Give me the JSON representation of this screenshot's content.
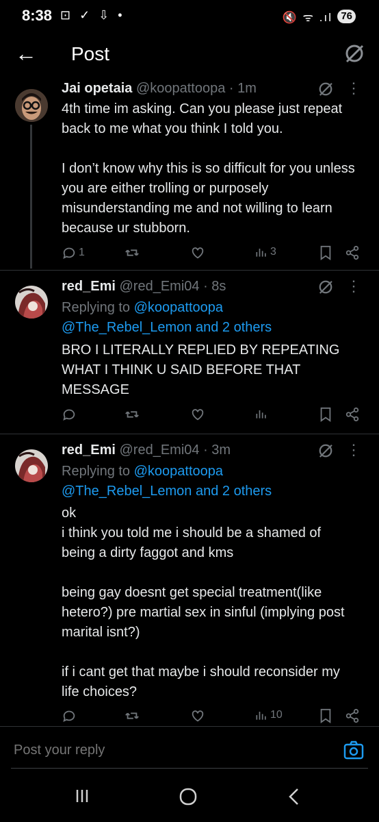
{
  "status": {
    "time": "8:38",
    "left_icons": "⊡ ✓ ⇩ •",
    "right_icons": "🔇 ᯤ .ıl",
    "battery": "76"
  },
  "header": {
    "title": "Post"
  },
  "posts": [
    {
      "name": "Jai opetaia",
      "handle": "@koopattoopa · 1m",
      "text": "4th time im asking. Can you please just repeat back to me what you think I told you.\n\nI don’t know why this is so difficult for you unless you are either trolling or purposely misunderstanding me and not willing to learn because ur stubborn.",
      "replies": "1",
      "views": "3"
    },
    {
      "name": "red_Emi",
      "handle": "@red_Emi04 · 8s",
      "replying_prefix": "Replying to ",
      "replying_to": "@koopattoopa",
      "replying_others": "@The_Rebel_Lemon and 2 others",
      "text": "BRO I LITERALLY REPLIED BY REPEATING WHAT I THINK U SAID BEFORE THAT MESSAGE",
      "views": ""
    },
    {
      "name": "red_Emi",
      "handle": "@red_Emi04 · 3m",
      "replying_prefix": "Replying to ",
      "replying_to": "@koopattoopa",
      "replying_others": "@The_Rebel_Lemon and 2 others",
      "text": "ok\ni think you told me i should be a shamed of being a dirty faggot and kms\n\nbeing gay doesnt get special treatment(like hetero?) pre martial sex in sinful (implying post marital isnt?)\n\nif i cant get that maybe i should reconsider my life choices?",
      "views": "10"
    }
  ],
  "reply_bar": {
    "placeholder": "Post your reply"
  },
  "colors": {
    "accent": "#1d9bf0",
    "muted": "#71767b",
    "text": "#e7e9ea",
    "background": "#000000"
  }
}
